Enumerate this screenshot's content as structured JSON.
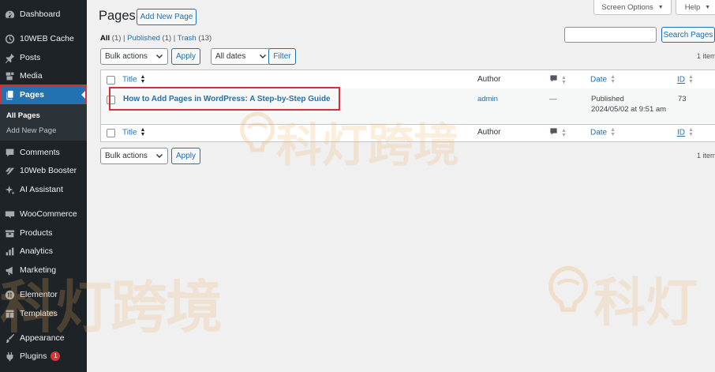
{
  "sidebar": {
    "items": [
      {
        "label": "Dashboard",
        "icon": "dashboard-icon"
      },
      {
        "label": "10WEB Cache",
        "icon": "cache-icon"
      },
      {
        "label": "Posts",
        "icon": "pin-icon"
      },
      {
        "label": "Media",
        "icon": "media-icon"
      },
      {
        "label": "Pages",
        "icon": "pages-icon"
      },
      {
        "label": "Comments",
        "icon": "comment-icon"
      },
      {
        "label": "10Web Booster",
        "icon": "booster-icon"
      },
      {
        "label": "AI Assistant",
        "icon": "sparkle-icon"
      },
      {
        "label": "WooCommerce",
        "icon": "woo-icon"
      },
      {
        "label": "Products",
        "icon": "products-icon"
      },
      {
        "label": "Analytics",
        "icon": "analytics-icon"
      },
      {
        "label": "Marketing",
        "icon": "megaphone-icon"
      },
      {
        "label": "Elementor",
        "icon": "elementor-icon"
      },
      {
        "label": "Templates",
        "icon": "templates-icon"
      },
      {
        "label": "Appearance",
        "icon": "brush-icon"
      },
      {
        "label": "Plugins",
        "icon": "plugin-icon",
        "badge": "1"
      }
    ],
    "submenu": {
      "all_pages": "All Pages",
      "add_new_page": "Add New Page"
    }
  },
  "header": {
    "title": "Pages",
    "add_new": "Add New Page",
    "screen_options": "Screen Options",
    "help": "Help"
  },
  "filters": {
    "all": "All",
    "all_count": "(1)",
    "published": "Published",
    "published_count": "(1)",
    "trash": "Trash",
    "trash_count": "(13)",
    "sep": "|"
  },
  "search": {
    "placeholder": "",
    "button": "Search Pages"
  },
  "toolbar": {
    "bulk_actions": "Bulk actions",
    "apply": "Apply",
    "all_dates": "All dates",
    "filter": "Filter",
    "items_count": "1 item"
  },
  "table": {
    "columns": {
      "title": "Title",
      "author": "Author",
      "date": "Date",
      "id": "ID"
    },
    "rows": [
      {
        "title": "How to Add Pages in WordPress: A Step-by-Step Guide",
        "author": "admin",
        "comments": "—",
        "status": "Published",
        "date": "2024/05/02 at 9:51 am",
        "id": "73"
      }
    ]
  },
  "watermark": {
    "text": "科灯跨境",
    "text_partial": "科灯"
  },
  "colors": {
    "sidebar_bg": "#1d2327",
    "accent": "#2271b1",
    "highlight_box": "#d0313b"
  }
}
